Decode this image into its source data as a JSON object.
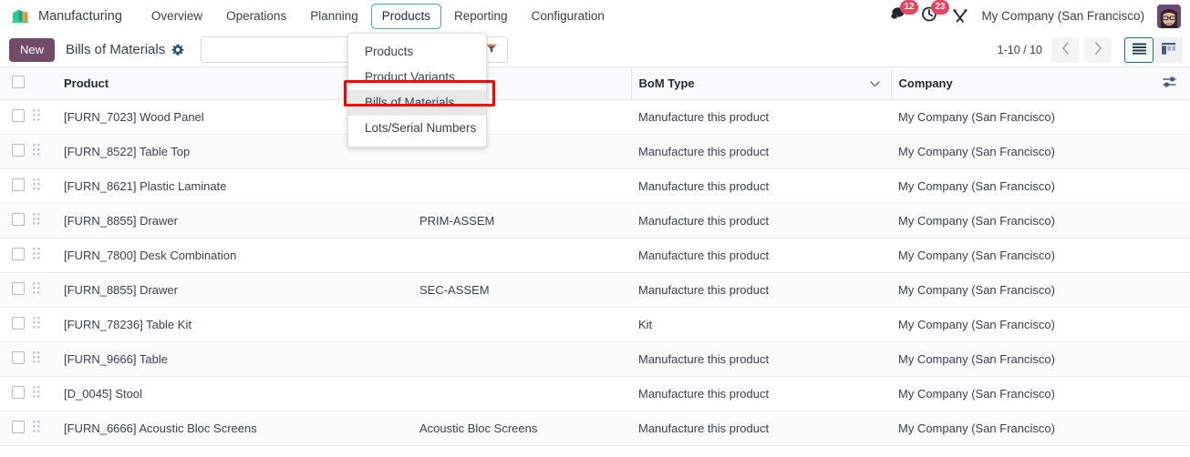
{
  "navbar": {
    "brand": "Manufacturing",
    "brand_logo_icon": "manufacturing-logo-icon",
    "menu_items": [
      {
        "label": "Overview",
        "active": false
      },
      {
        "label": "Operations",
        "active": false
      },
      {
        "label": "Planning",
        "active": false
      },
      {
        "label": "Products",
        "active": true
      },
      {
        "label": "Reporting",
        "active": false
      },
      {
        "label": "Configuration",
        "active": false
      }
    ],
    "messages_badge": "12",
    "messages_icon": "chat-bubble-icon",
    "activities_badge": "23",
    "activities_icon": "clock-activity-icon",
    "tools_icon": "crossed-tools-icon",
    "company": "My Company (San Francisco)",
    "avatar_icon": "user-avatar"
  },
  "dropdown": {
    "items": [
      {
        "label": "Products",
        "highlighted": false
      },
      {
        "label": "Product Variants",
        "highlighted": false
      },
      {
        "label": "Bills of Materials",
        "highlighted": true
      },
      {
        "label": "Lots/Serial Numbers",
        "highlighted": false
      }
    ]
  },
  "control_panel": {
    "new_label": "New",
    "title": "Bills of Materials",
    "gear_icon": "gear-icon",
    "search": {
      "value": "",
      "placeholder": "",
      "toggle_icon": "filter-dropdown-icon"
    },
    "pager": {
      "range": "1-10 / 10",
      "prev_icon": "chevron-left-icon",
      "next_icon": "chevron-right-icon"
    },
    "views": [
      {
        "name": "list",
        "icon": "list-view-icon",
        "active": true
      },
      {
        "name": "kanban",
        "icon": "kanban-view-icon",
        "active": false
      }
    ]
  },
  "table": {
    "columns": [
      {
        "key": "product",
        "label": "Product",
        "sortable": false
      },
      {
        "key": "reference",
        "label": "",
        "sortable": false
      },
      {
        "key": "bom_type",
        "label": "BoM Type",
        "sortable": true,
        "icon": "chevron-down-icon"
      },
      {
        "key": "company",
        "label": "Company",
        "sortable": false
      }
    ],
    "optional_columns_icon": "column-settings-icon",
    "rows": [
      {
        "product": "[FURN_7023] Wood Panel",
        "reference": "",
        "bom_type": "Manufacture this product",
        "company": "My Company (San Francisco)"
      },
      {
        "product": "[FURN_8522] Table Top",
        "reference": "",
        "bom_type": "Manufacture this product",
        "company": "My Company (San Francisco)"
      },
      {
        "product": "[FURN_8621] Plastic Laminate",
        "reference": "",
        "bom_type": "Manufacture this product",
        "company": "My Company (San Francisco)"
      },
      {
        "product": "[FURN_8855] Drawer",
        "reference": "PRIM-ASSEM",
        "bom_type": "Manufacture this product",
        "company": "My Company (San Francisco)"
      },
      {
        "product": "[FURN_7800] Desk Combination",
        "reference": "",
        "bom_type": "Manufacture this product",
        "company": "My Company (San Francisco)"
      },
      {
        "product": "[FURN_8855] Drawer",
        "reference": "SEC-ASSEM",
        "bom_type": "Manufacture this product",
        "company": "My Company (San Francisco)"
      },
      {
        "product": "[FURN_78236] Table Kit",
        "reference": "",
        "bom_type": "Kit",
        "company": "My Company (San Francisco)"
      },
      {
        "product": "[FURN_9666] Table",
        "reference": "",
        "bom_type": "Manufacture this product",
        "company": "My Company (San Francisco)"
      },
      {
        "product": "[D_0045] Stool",
        "reference": "",
        "bom_type": "Manufacture this product",
        "company": "My Company (San Francisco)"
      },
      {
        "product": "[FURN_6666] Acoustic Bloc Screens",
        "reference": "Acoustic Bloc Screens",
        "bom_type": "Manufacture this product",
        "company": "My Company (San Francisco)"
      }
    ]
  },
  "colors": {
    "brand_purple": "#714b67",
    "accent_teal": "#22707a",
    "badge_red": "#e6455d",
    "annotation_red": "#ff0000"
  }
}
